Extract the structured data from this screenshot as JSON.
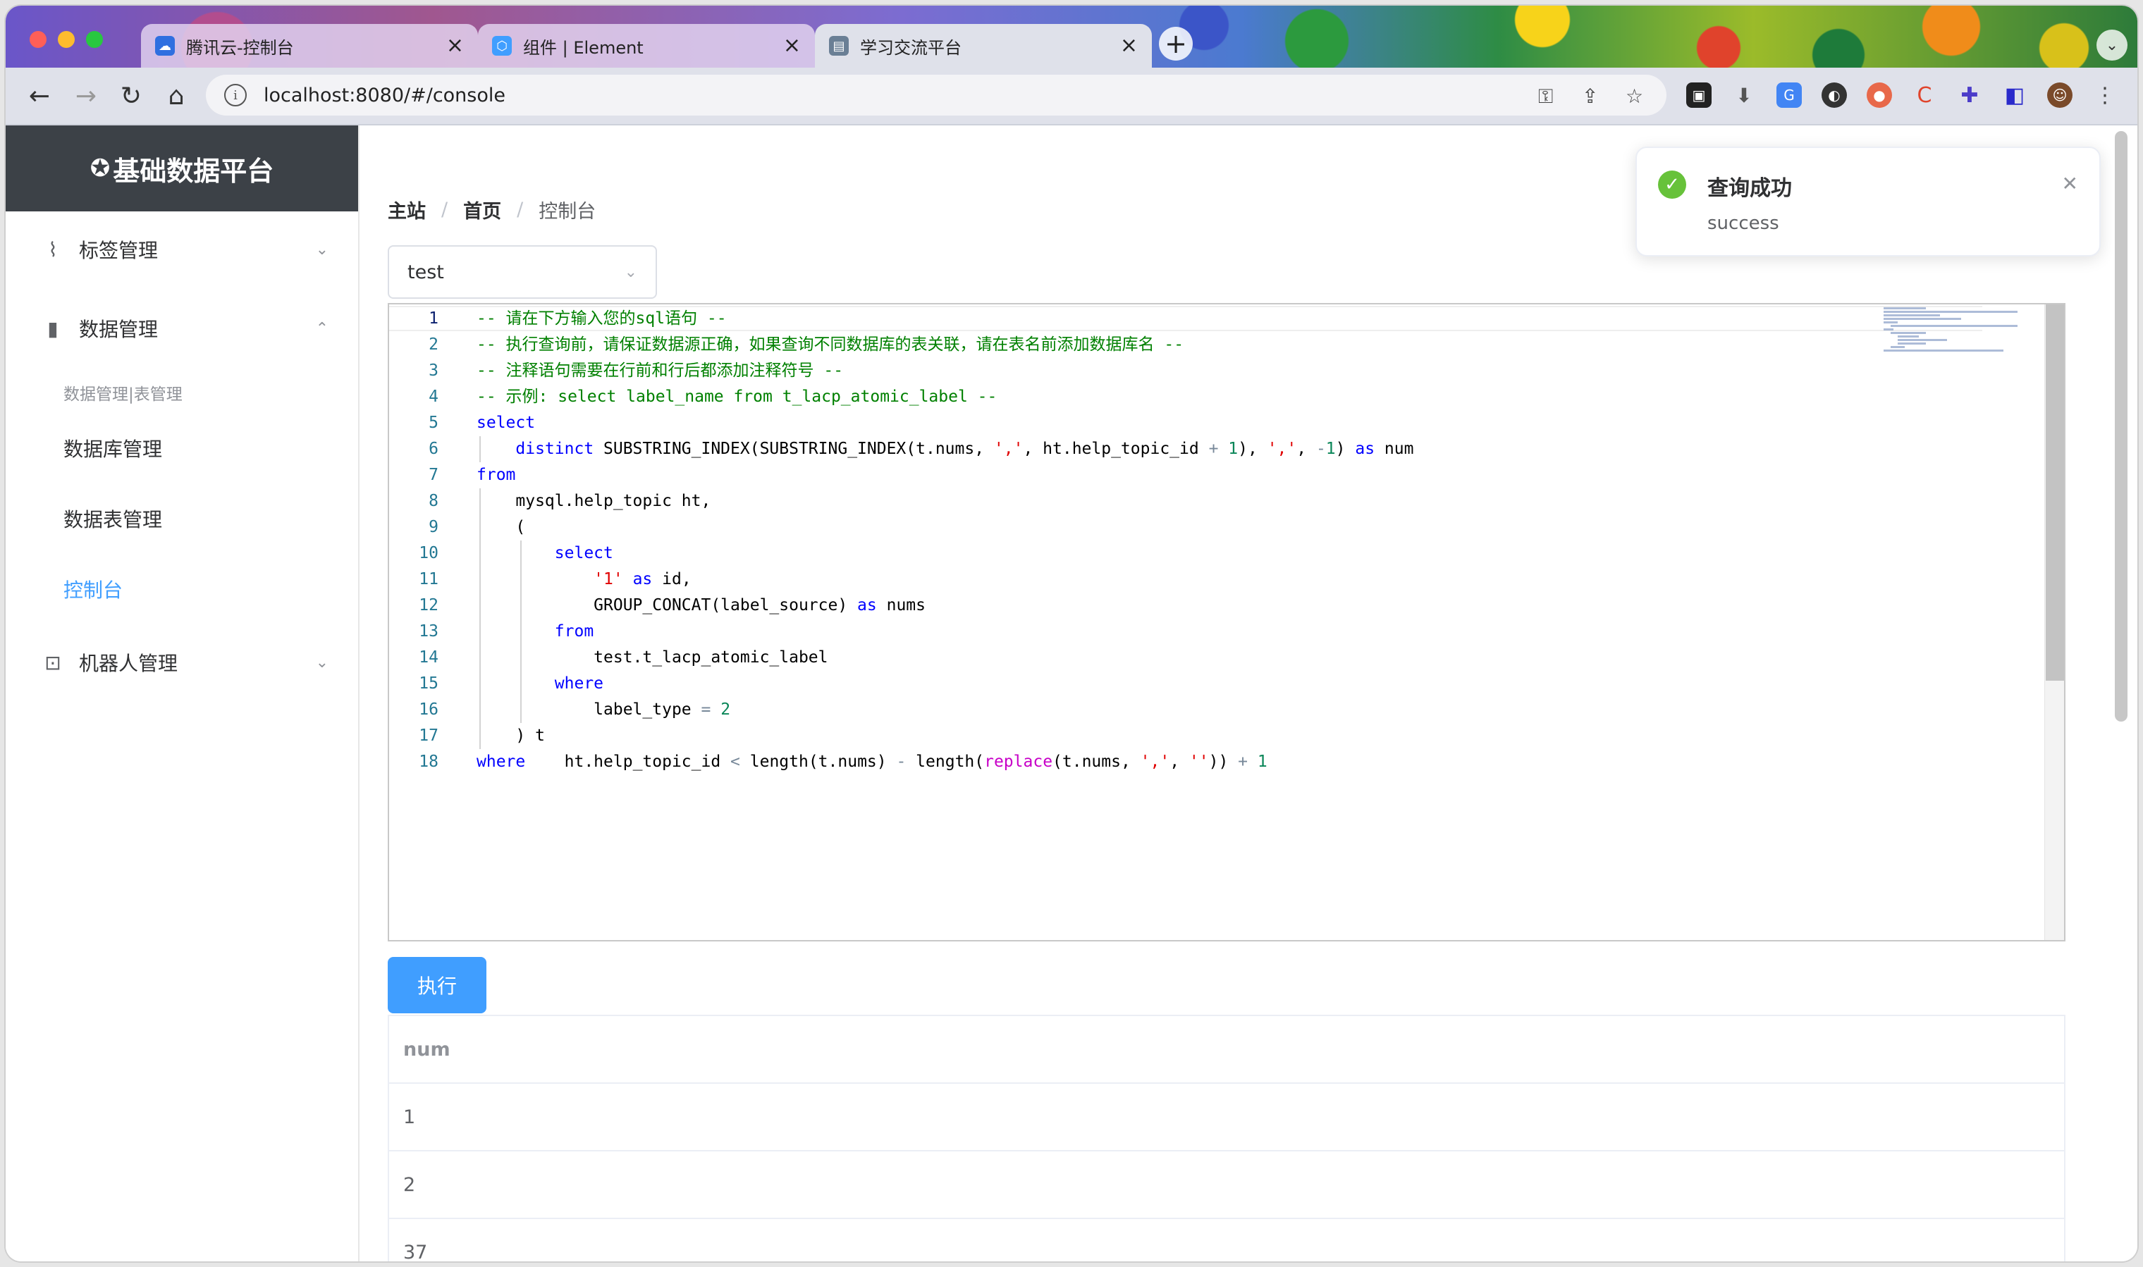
{
  "browser": {
    "tabs": [
      {
        "title": "腾讯云-控制台",
        "active": false
      },
      {
        "title": "组件 | Element",
        "active": false
      },
      {
        "title": "学习交流平台",
        "active": true
      }
    ],
    "url": "localhost:8080/#/console"
  },
  "sidebar": {
    "brand": "基础数据平台",
    "groups": [
      {
        "label": "标签管理",
        "icon": "paperclip-icon",
        "expanded": false
      },
      {
        "label": "数据管理",
        "icon": "bar-chart-icon",
        "expanded": true
      },
      {
        "label": "机器人管理",
        "icon": "robot-icon",
        "expanded": false
      }
    ],
    "group_title": "数据管理|表管理",
    "items": [
      {
        "label": "数据库管理",
        "active": false
      },
      {
        "label": "数据表管理",
        "active": false
      },
      {
        "label": "控制台",
        "active": true
      }
    ]
  },
  "breadcrumb": [
    "主站",
    "首页",
    "控制台"
  ],
  "datasource_select": {
    "value": "test"
  },
  "editor": {
    "line_numbers": [
      "1",
      "2",
      "3",
      "4",
      "5",
      "6",
      "7",
      "8",
      "9",
      "10",
      "11",
      "12",
      "13",
      "14",
      "15",
      "16",
      "17",
      "18"
    ],
    "lines": [
      "-- 请在下方输入您的sql语句 --",
      "-- 执行查询前，请保证数据源正确，如果查询不同数据库的表关联，请在表名前添加数据库名 --",
      "-- 注释语句需要在行前和行后都添加注释符号 --",
      "-- 示例: select label_name from t_lacp_atomic_label --",
      "select",
      "    distinct SUBSTRING_INDEX(SUBSTRING_INDEX(t.nums, ',', ht.help_topic_id + 1), ',', -1) as num",
      "from",
      "    mysql.help_topic ht,",
      "    (",
      "        select",
      "            '1' as id,",
      "            GROUP_CONCAT(label_source) as nums",
      "        from",
      "            test.t_lacp_atomic_label",
      "        where",
      "            label_type = 2",
      "    ) t",
      "where    ht.help_topic_id < length(t.nums) - length(replace(t.nums, ',', '')) + 1"
    ]
  },
  "run_button": "执行",
  "result_table": {
    "columns": [
      "num"
    ],
    "rows": [
      [
        "1"
      ],
      [
        "2"
      ],
      [
        "37"
      ]
    ]
  },
  "toast": {
    "title": "查询成功",
    "message": "success",
    "status_color": "#67c23a"
  },
  "colors": {
    "primary": "#409eff",
    "sidebar_header": "#3c4147"
  }
}
